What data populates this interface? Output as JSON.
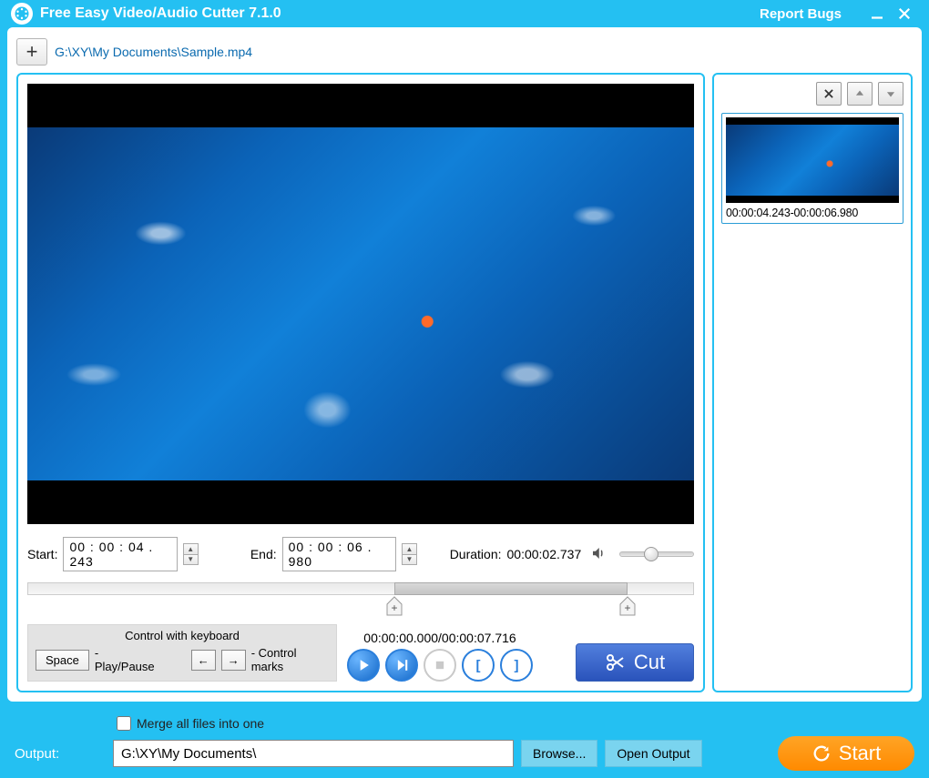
{
  "title": "Free Easy Video/Audio Cutter 7.1.0",
  "report_label": "Report Bugs",
  "file_path": "G:\\XY\\My Documents\\Sample.mp4",
  "start_label": "Start:",
  "start_value": "00 : 00 : 04 . 243",
  "end_label": "End:",
  "end_value": "00 : 00 : 06 . 980",
  "duration_label": "Duration:",
  "duration_value": "00:00:02.737",
  "timeline_text": "00:00:00.000/00:00:07.716",
  "kb_header": "Control with keyboard",
  "kb_space": "Space",
  "kb_playpause": "- Play/Pause",
  "kb_left": "←",
  "kb_right": "→",
  "kb_marks": "- Control marks",
  "cut_label": "Cut",
  "clip_range": "00:00:04.243-00:00:06.980",
  "merge_label": "Merge all files into one",
  "output_label": "Output:",
  "output_path": "G:\\XY\\My Documents\\",
  "browse_label": "Browse...",
  "openout_label": "Open Output",
  "start_btn_label": "Start",
  "sel_start_pct": 55,
  "sel_end_pct": 90,
  "vol_pct": 35
}
